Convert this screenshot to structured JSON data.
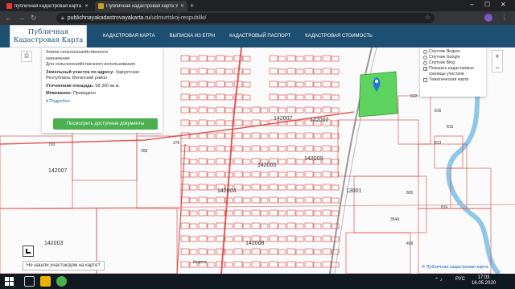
{
  "browser": {
    "tabs": [
      {
        "title": "публичная кадастровая карта - ",
        "active": false
      },
      {
        "title": "Публичная кадастровая карта У",
        "active": true
      }
    ],
    "url_domain": "publichnayakadastrovayakarta.ru",
    "url_path": "/udmurtskoj-respubliki/"
  },
  "site": {
    "logo_line1": "Публичная",
    "logo_line2": "Кадастровая Карта",
    "nav": [
      "Кадастровая карта",
      "Выписка из ЕГРН",
      "Кадастровый паспорт",
      "Кадастровая стоимость"
    ]
  },
  "info": {
    "line1": "Земли сельскохозяйственного",
    "line2": "назначения",
    "line3": "Для сельскохозяйственного использования",
    "address_label": "Земельный участок по адресу:",
    "address_value": "Удмуртская Республика, Вятинский район",
    "area_label": "Уточненная площадь:",
    "area_value": "58 300 кв.м.",
    "survey_label": "Межевание:",
    "survey_value": "Проведено",
    "more_link": "Подробно",
    "docs_button": "Посмотреть доступные документы"
  },
  "layers": {
    "items": [
      {
        "label": "Спутник Яндекс",
        "type": "radio"
      },
      {
        "label": "Спутник Google",
        "type": "radio"
      },
      {
        "label": "Спутник Bing",
        "type": "radio"
      },
      {
        "label": "Показать кадастровые границы участков",
        "type": "check",
        "checked": true
      },
      {
        "label": "Тематическая карта",
        "type": "check",
        "checked": false
      }
    ]
  },
  "map": {
    "labels": [
      "142007",
      "142007",
      "142002",
      "142005",
      "142008",
      "142004",
      "142009",
      "142003",
      "13001",
      "376",
      "268",
      "703",
      "622",
      "816",
      "815",
      "813",
      "805",
      "816",
      "3546",
      "499",
      "Кварса"
    ],
    "not_found": "Не нашли участок/дом на карте?",
    "copyright": "© Публичная кадастровая карта",
    "colors": {
      "parcel_line": "#d93b3b",
      "selected_fill": "#5fd35f",
      "pin": "#2277d8"
    }
  },
  "taskbar": {
    "lang": "РУС",
    "time": "17:03",
    "date": "16.05.2020"
  }
}
